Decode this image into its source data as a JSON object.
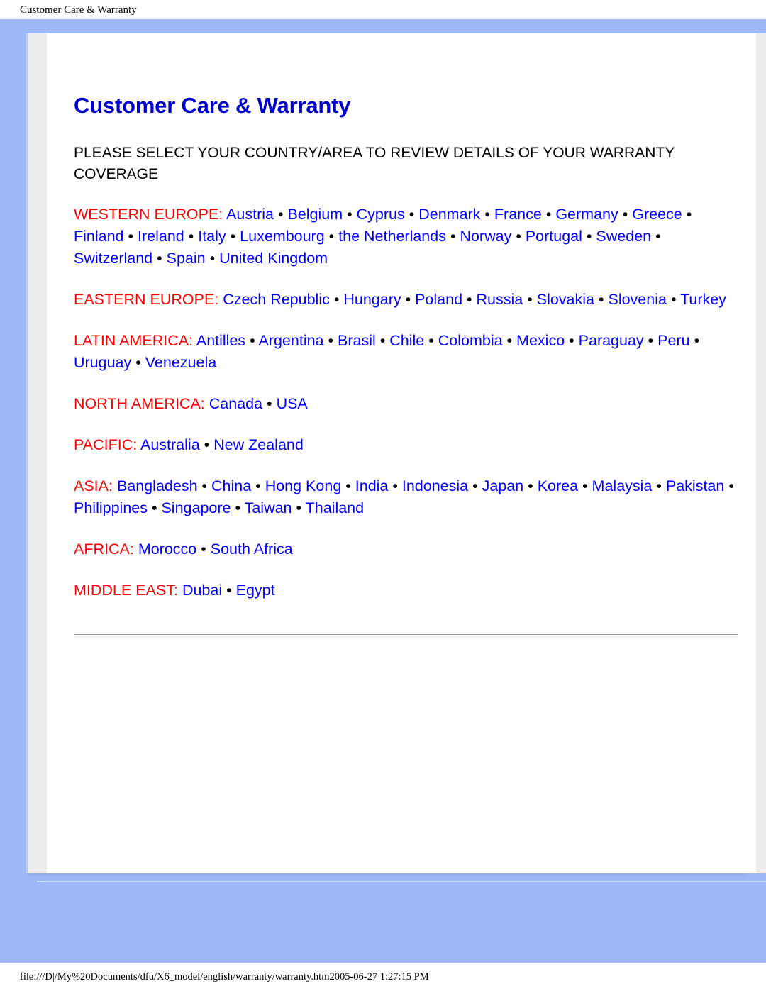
{
  "browser_print_header": {
    "title": "Customer Care & Warranty"
  },
  "document": {
    "title": "Customer Care & Warranty",
    "instruction": "PLEASE SELECT YOUR COUNTRY/AREA TO REVIEW DETAILS OF YOUR WARRANTY COVERAGE",
    "separator": "•",
    "label_suffix": ":",
    "regions": [
      {
        "label": "WESTERN EUROPE",
        "countries": [
          "Austria",
          "Belgium",
          "Cyprus",
          "Denmark",
          "France",
          "Germany",
          "Greece",
          "Finland",
          "Ireland",
          "Italy",
          "Luxembourg",
          "the Netherlands",
          "Norway",
          "Portugal",
          "Sweden",
          "Switzerland",
          "Spain",
          "United Kingdom"
        ]
      },
      {
        "label": "EASTERN EUROPE",
        "countries": [
          "Czech Republic",
          "Hungary",
          "Poland",
          "Russia",
          "Slovakia",
          "Slovenia",
          "Turkey"
        ]
      },
      {
        "label": "LATIN AMERICA",
        "countries": [
          "Antilles",
          "Argentina",
          "Brasil",
          "Chile",
          "Colombia",
          "Mexico",
          "Paraguay",
          "Peru",
          "Uruguay",
          "Venezuela"
        ]
      },
      {
        "label": "NORTH AMERICA",
        "countries": [
          "Canada",
          "USA"
        ]
      },
      {
        "label": "PACIFIC",
        "countries": [
          "Australia",
          "New Zealand"
        ]
      },
      {
        "label": "ASIA",
        "countries": [
          "Bangladesh",
          "China",
          "Hong Kong",
          "India",
          "Indonesia",
          "Japan",
          "Korea",
          "Malaysia",
          "Pakistan",
          "Philippines",
          "Singapore",
          "Taiwan",
          "Thailand"
        ]
      },
      {
        "label": "AFRICA",
        "countries": [
          "Morocco",
          "South Africa"
        ]
      },
      {
        "label": "MIDDLE EAST",
        "countries": [
          "Dubai",
          "Egypt"
        ]
      }
    ]
  },
  "browser_print_footer": {
    "text": "file:///D|/My%20Documents/dfu/X6_model/english/warranty/warranty.htm2005-06-27 1:27:15 PM"
  },
  "colors": {
    "page_background": "#9cb8f7",
    "sheet_background": "#ffffff",
    "gutter": "#ececec",
    "title": "#0000cc",
    "region_label": "#ff0000",
    "country_link": "#0000ff",
    "separator": "#000000",
    "body_text": "#000000"
  }
}
